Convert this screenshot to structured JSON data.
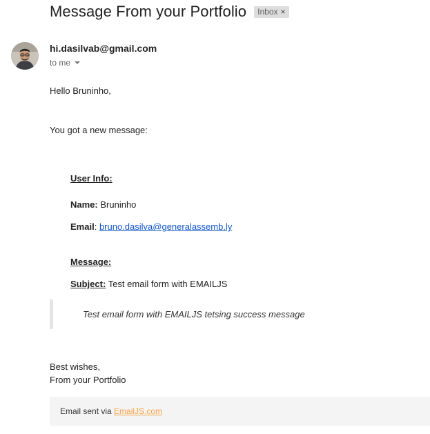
{
  "email": {
    "subject": "Message From your Portfolio",
    "label": "Inbox",
    "label_close": "×",
    "sender": "hi.dasilvab@gmail.com",
    "recipient": "to me"
  },
  "body": {
    "greeting": "Hello Bruninho,",
    "intro": "You got a new message:",
    "user_info_heading": "User Info:",
    "name_label": "Name:",
    "name_value": "Bruninho",
    "email_label": "Email",
    "email_sep": ":",
    "email_value": "bruno.dasilva@generalassemb.ly",
    "message_heading": "Message:",
    "subject_label": "Subject",
    "subject_sep": ":",
    "subject_value": "Test email form with EMAILJS",
    "message_text": "Test email form with EMAILJS tetsing success message",
    "signoff_1": "Best wishes,",
    "signoff_2": "From your Portfolio"
  },
  "footer": {
    "text": "Email sent via",
    "link": "EmailJS.com",
    "link_color": "#f4a343"
  }
}
